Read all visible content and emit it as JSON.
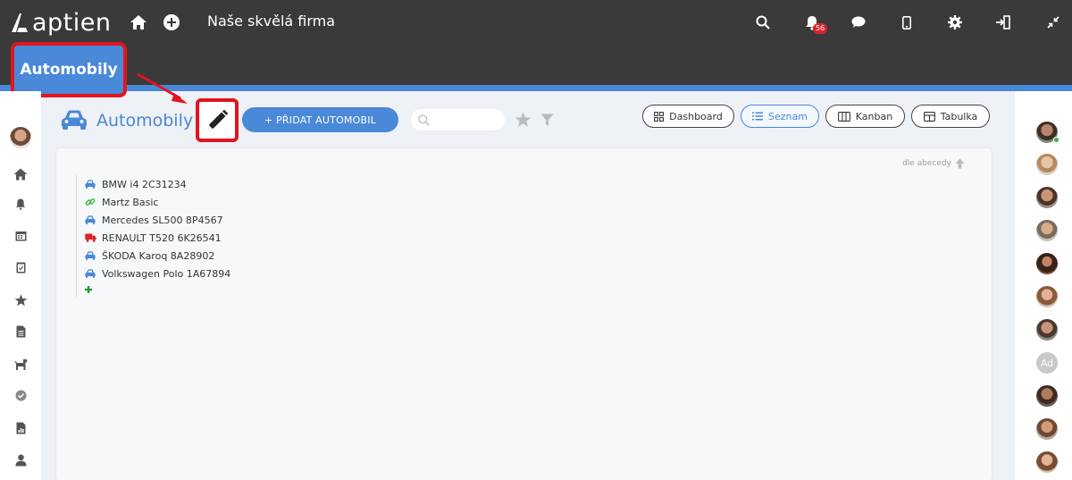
{
  "header": {
    "logo_text": "aptien",
    "company_name": "Naše skvělá firma",
    "notification_count": "56",
    "icons": [
      "home-icon",
      "plus-circle-icon",
      "search-icon",
      "bell-icon",
      "chat-icon",
      "mobile-icon",
      "gear-icon",
      "logout-icon",
      "compress-icon"
    ]
  },
  "callout": {
    "label": "Automobily"
  },
  "page": {
    "title": "Automobily",
    "add_button": "+ PŘIDAT AUTOMOBIL",
    "search_placeholder": ""
  },
  "views": [
    {
      "label": "Dashboard",
      "active": false,
      "icon": "grid-icon"
    },
    {
      "label": "Seznam",
      "active": true,
      "icon": "list-icon"
    },
    {
      "label": "Kanban",
      "active": false,
      "icon": "columns-icon"
    },
    {
      "label": "Tabulka",
      "active": false,
      "icon": "table-icon"
    }
  ],
  "sort_label": "dle abecedy",
  "items": [
    {
      "label": "BMW i4 2C31234",
      "icon": "car-icon",
      "color": "#4a88d8"
    },
    {
      "label": "Martz Basic",
      "icon": "link-icon",
      "color": "#3cb44a"
    },
    {
      "label": "Mercedes SL500 8P4567",
      "icon": "car-icon",
      "color": "#4a88d8"
    },
    {
      "label": "RENAULT T520 6K26541",
      "icon": "truck-icon",
      "color": "#d9252a"
    },
    {
      "label": "ŠKODA Karoq 8A28902",
      "icon": "car-icon",
      "color": "#4a88d8"
    },
    {
      "label": "Volkswagen Polo 1A67894",
      "icon": "car-icon",
      "color": "#4a88d8"
    }
  ],
  "left_sidebar": [
    "user-avatar",
    "home-icon",
    "bell-icon",
    "calendar-icon",
    "clipboard-icon",
    "star-icon",
    "document-icon",
    "dog-icon",
    "check-circle-icon",
    "report-icon",
    "person-icon"
  ],
  "right_sidebar_avatar_initials": "Ad",
  "colors": {
    "accent": "#4a88d8",
    "topbar": "#3a3a3a",
    "highlight": "#e2141d"
  }
}
